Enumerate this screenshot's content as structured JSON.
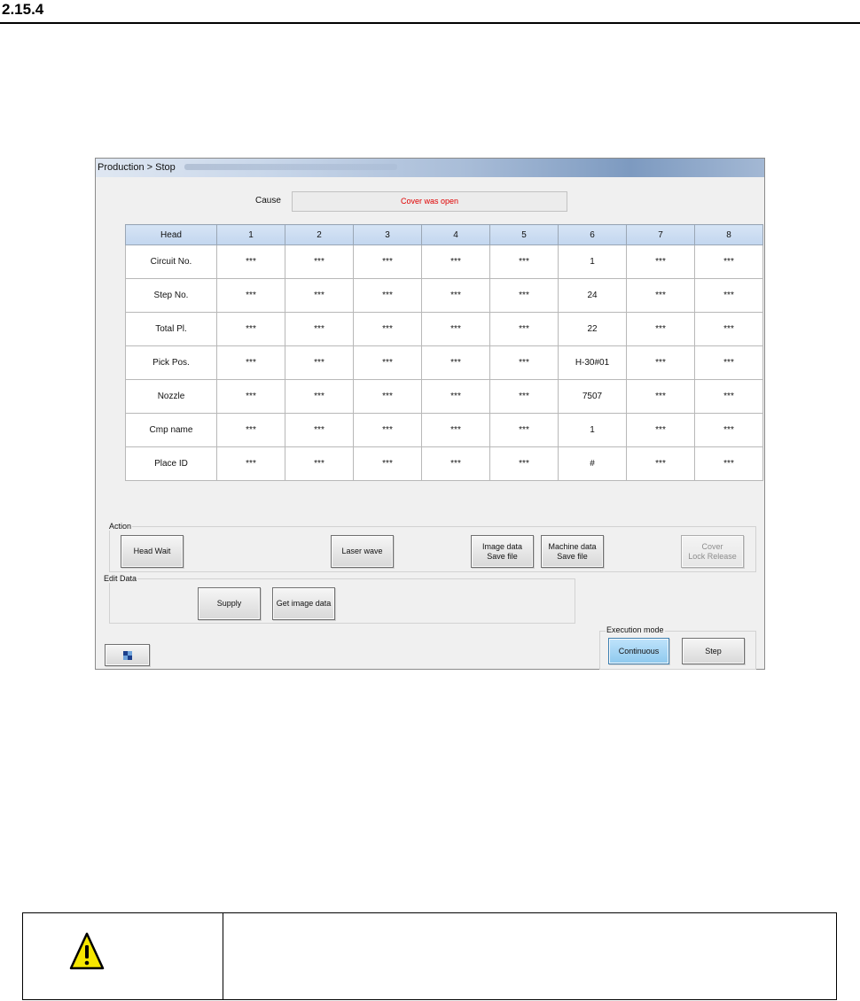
{
  "section": {
    "number": "2.15.4"
  },
  "window": {
    "title": "Production > Stop",
    "cause_label": "Cause",
    "cause_value": "Cover was open",
    "cause_color": "#e00000"
  },
  "table": {
    "header_label": "Head",
    "columns": [
      "1",
      "2",
      "3",
      "4",
      "5",
      "6",
      "7",
      "8"
    ],
    "rows": [
      {
        "label": "Circuit No.",
        "values": [
          "***",
          "***",
          "***",
          "***",
          "***",
          "1",
          "***",
          "***"
        ]
      },
      {
        "label": "Step No.",
        "values": [
          "***",
          "***",
          "***",
          "***",
          "***",
          "24",
          "***",
          "***"
        ]
      },
      {
        "label": "Total Pl.",
        "values": [
          "***",
          "***",
          "***",
          "***",
          "***",
          "22",
          "***",
          "***"
        ]
      },
      {
        "label": "Pick Pos.",
        "values": [
          "***",
          "***",
          "***",
          "***",
          "***",
          "H-30#01",
          "***",
          "***"
        ]
      },
      {
        "label": "Nozzle",
        "values": [
          "***",
          "***",
          "***",
          "***",
          "***",
          "7507",
          "***",
          "***"
        ]
      },
      {
        "label": "Cmp name",
        "values": [
          "***",
          "***",
          "***",
          "***",
          "***",
          "1",
          "***",
          "***"
        ]
      },
      {
        "label": "Place ID",
        "values": [
          "***",
          "***",
          "***",
          "***",
          "***",
          "#",
          "***",
          "***"
        ]
      }
    ]
  },
  "action": {
    "label": "Action",
    "head_wait": "Head Wait",
    "laser_wave": "Laser wave",
    "image_data_save_line1": "Image data",
    "image_data_save_line2": "Save file",
    "machine_data_save_line1": "Machine data",
    "machine_data_save_line2": "Save file",
    "cover_lock_line1": "Cover",
    "cover_lock_line2": "Lock Release"
  },
  "edit_data": {
    "label": "Edit Data",
    "supply": "Supply",
    "get_image_data": "Get image data"
  },
  "execution_mode": {
    "label": "Execution mode",
    "continuous": "Continuous",
    "step": "Step",
    "active": "Continuous",
    "active_color": "#8ec9ee"
  },
  "icons": {
    "window_toggle": "window-layout-icon",
    "warning": "warning-triangle-icon",
    "warning_color": "#f5e600"
  }
}
